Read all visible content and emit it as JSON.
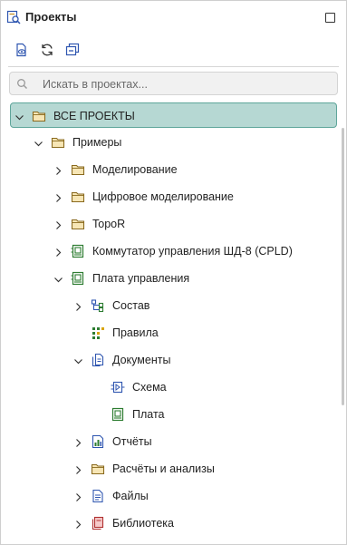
{
  "panel": {
    "title": "Проекты",
    "title_icon": "projects-search-icon",
    "maximize_icon": "maximize-icon"
  },
  "toolbar": {
    "buttons": [
      {
        "icon": "show-file-icon"
      },
      {
        "icon": "refresh-icon"
      },
      {
        "icon": "collapse-all-icon"
      }
    ]
  },
  "search": {
    "placeholder": "Искать в проектах...",
    "value": "",
    "icon": "search-icon"
  },
  "tree": {
    "items": [
      {
        "label": "ВСЕ ПРОЕКТЫ",
        "icon": "folder-icon",
        "chevron": "down",
        "selected": true
      },
      {
        "label": "Примеры",
        "icon": "folder-icon",
        "chevron": "down"
      },
      {
        "label": "Моделирование",
        "icon": "folder-icon",
        "chevron": "right"
      },
      {
        "label": "Цифровое моделирование",
        "icon": "folder-icon",
        "chevron": "right"
      },
      {
        "label": "TopoR",
        "icon": "folder-icon",
        "chevron": "right"
      },
      {
        "label": "Коммутатор управления ШД-8 (CPLD)",
        "icon": "board-project-icon",
        "chevron": "right"
      },
      {
        "label": "Плата управления",
        "icon": "board-project-icon",
        "chevron": "down"
      },
      {
        "label": "Состав",
        "icon": "structure-icon",
        "chevron": "right"
      },
      {
        "label": "Правила",
        "icon": "rules-icon",
        "chevron": "none"
      },
      {
        "label": "Документы",
        "icon": "documents-icon",
        "chevron": "down"
      },
      {
        "label": "Схема",
        "icon": "schematic-icon",
        "chevron": "none"
      },
      {
        "label": "Плата",
        "icon": "pcb-icon",
        "chevron": "none"
      },
      {
        "label": "Отчёты",
        "icon": "reports-icon",
        "chevron": "right"
      },
      {
        "label": "Расчёты и анализы",
        "icon": "folder-icon",
        "chevron": "right"
      },
      {
        "label": "Файлы",
        "icon": "file-icon",
        "chevron": "right"
      },
      {
        "label": "Библиотека",
        "icon": "library-icon",
        "chevron": "right"
      }
    ]
  },
  "colors": {
    "selection_fill": "#b6d8d3",
    "selection_border": "#5fa69b",
    "folder_fill": "#f7e6b5",
    "folder_stroke": "#8a6a1f",
    "icon_blue": "#2f56b0",
    "icon_green": "#2e7d32"
  }
}
